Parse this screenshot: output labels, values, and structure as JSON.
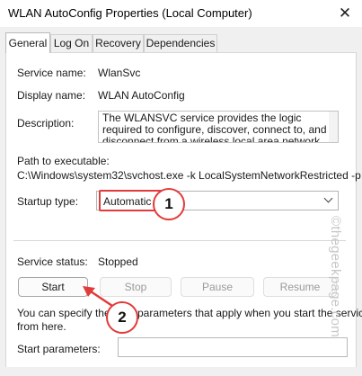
{
  "window": {
    "title": "WLAN AutoConfig Properties (Local Computer)",
    "close_glyph": "✕"
  },
  "tabs": [
    {
      "label": "General",
      "active": true
    },
    {
      "label": "Log On",
      "active": false
    },
    {
      "label": "Recovery",
      "active": false
    },
    {
      "label": "Dependencies",
      "active": false
    }
  ],
  "general": {
    "service_name_label": "Service name:",
    "service_name_value": "WlanSvc",
    "display_name_label": "Display name:",
    "display_name_value": "WLAN AutoConfig",
    "description_label": "Description:",
    "description_value": "The WLANSVC service provides the logic required to configure, discover, connect to, and disconnect from a wireless local area network (WLAN) as",
    "path_label": "Path to executable:",
    "path_value": "C:\\Windows\\system32\\svchost.exe -k LocalSystemNetworkRestricted -p",
    "startup_type_label": "Startup type:",
    "startup_type_value": "Automatic",
    "service_status_label": "Service status:",
    "service_status_value": "Stopped",
    "buttons": {
      "start": "Start",
      "stop": "Stop",
      "pause": "Pause",
      "resume": "Resume"
    },
    "hint_text_left": "You can specify the s",
    "hint_text_right": "parameters that apply when you start the service",
    "hint_text_line2": "from here.",
    "start_parameters_label": "Start parameters:",
    "start_parameters_value": ""
  },
  "annotations": {
    "badge_1": "1",
    "badge_2": "2",
    "accent_color": "#e23b3b"
  },
  "watermark": "©thegeekpage.com"
}
